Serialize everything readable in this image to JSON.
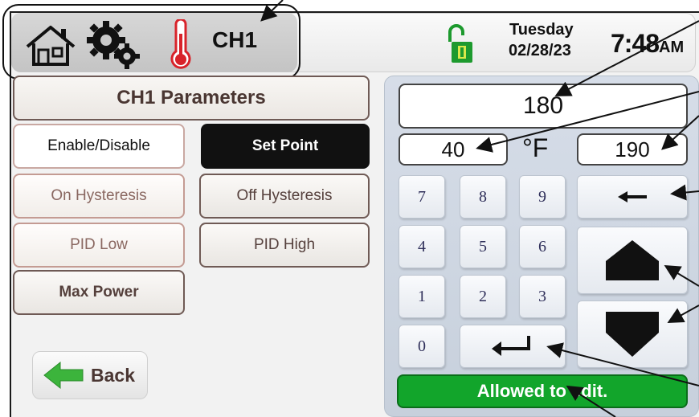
{
  "header": {
    "channel_title": "CH1",
    "day": "Tuesday",
    "date": "02/28/23",
    "time": "7:48",
    "ampm": "AM",
    "icons": [
      "home-icon",
      "gear-icon",
      "thermometer-icon",
      "unlocked-padlock-icon"
    ]
  },
  "params": {
    "title": "CH1 Parameters",
    "buttons": {
      "enable_disable": "Enable/Disable",
      "set_point": "Set Point",
      "on_hysteresis": "On Hysteresis",
      "off_hysteresis": "Off Hysteresis",
      "pid_low": "PID Low",
      "pid_high": "PID High",
      "max_power": "Max Power"
    },
    "back_label": "Back"
  },
  "keypad": {
    "value": "180",
    "min": "40",
    "unit": "°F",
    "max": "190",
    "digits": [
      "7",
      "8",
      "9",
      "4",
      "5",
      "6",
      "1",
      "2",
      "3",
      "0"
    ],
    "status": "Allowed to edit."
  },
  "colors": {
    "status_green": "#12a52b",
    "selected_black": "#111111",
    "thermometer_red": "#d8232a",
    "lock_green": "#1d9a2e",
    "back_arrow_green": "#3cb43c"
  }
}
